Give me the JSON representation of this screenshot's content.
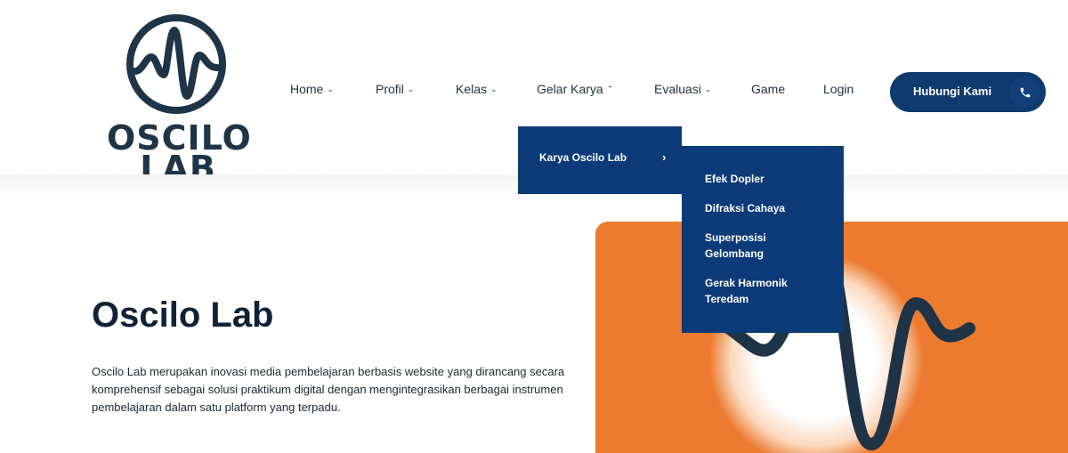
{
  "brand": {
    "line1": "OSCILO",
    "line2": "LAB"
  },
  "nav": [
    {
      "label": "Home",
      "chevron": "down"
    },
    {
      "label": "Profil",
      "chevron": "down"
    },
    {
      "label": "Kelas",
      "chevron": "down"
    },
    {
      "label": "Gelar Karya",
      "chevron": "up"
    },
    {
      "label": "Evaluasi",
      "chevron": "down"
    },
    {
      "label": "Game"
    },
    {
      "label": "Login"
    }
  ],
  "cta": {
    "label": "Hubungi Kami",
    "icon": "phone-icon"
  },
  "dropdown": {
    "label": "Karya Oscilo Lab",
    "arrow": "›",
    "submenu": [
      "Efek Dopler",
      "Difraksi Cahaya",
      "Superposisi Gelombang",
      "Gerak Harmonik Teredam"
    ]
  },
  "hero": {
    "title": "Oscilo Lab",
    "description": "Oscilo Lab merupakan inovasi media pembelajaran berbasis website yang dirancang secara komprehensif sebagai solusi praktikum digital dengan mengintegrasikan berbagai instrumen pembelajaran dalam satu platform yang terpadu."
  },
  "colors": {
    "primary": "#0b3a78",
    "cta": "#0f3a6d",
    "accent": "#ec7b2f",
    "text": "#1b2b3d"
  }
}
